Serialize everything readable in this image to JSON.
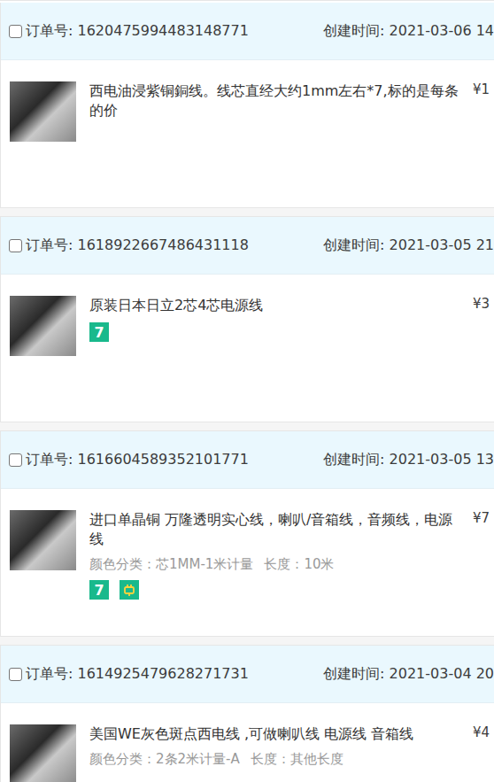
{
  "orders": [
    {
      "checked": false,
      "order_label": "订单号:",
      "order_no": "1620475994483148771",
      "created": "创建时间: 2021-03-06 14",
      "title": "西电油浸紫铜銅线。线芯直经大约1mm左右*7,标的是每条的价",
      "attrs": [],
      "badges": [],
      "price": "¥1"
    },
    {
      "checked": false,
      "order_label": "订单号:",
      "order_no": "1618922667486431118",
      "created": "创建时间: 2021-03-05 21",
      "title": "原装日本日立2芯4芯电源线",
      "attrs": [],
      "badges": [
        {
          "kind": "text",
          "text": "7"
        }
      ],
      "price": "¥3"
    },
    {
      "checked": false,
      "order_label": "订单号:",
      "order_no": "1616604589352101771",
      "created": "创建时间: 2021-03-05 13",
      "title": "进口单晶铜 万隆透明实心线，喇叭/音箱线，音频线，电源线",
      "attrs": [
        "颜色分类：芯1MM-1米计量",
        "长度：10米"
      ],
      "badges": [
        {
          "kind": "text",
          "text": "7"
        },
        {
          "kind": "icon",
          "text": ""
        }
      ],
      "price": "¥7"
    },
    {
      "checked": false,
      "order_label": "订单号:",
      "order_no": "1614925479628271731",
      "created": "创建时间: 2021-03-04 20",
      "title": "美国WE灰色斑点西电线 ,可做喇叭线 电源线 音箱线",
      "attrs": [
        "颜色分类：2条2米计量-A",
        "长度：其他长度"
      ],
      "badges": [],
      "price": "¥4"
    }
  ]
}
